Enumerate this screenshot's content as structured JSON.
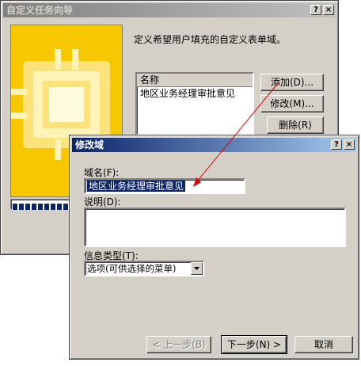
{
  "back_window": {
    "title": "自定义任务向导",
    "help_btn": "?",
    "close_btn": "×",
    "description": "定义希望用户填充的自定义表单域。",
    "list_header": "名称",
    "list_items": [
      "地区业务经理审批意见"
    ],
    "add_button": "添加(D)...",
    "modify_button": "修改(M)...",
    "delete_button": "删除(R)"
  },
  "dialog": {
    "title": "修改域",
    "help_btn": "?",
    "close_btn": "×",
    "field_name_label": "域名(F):",
    "field_name_value": "地区业务经理审批意见",
    "description_label": "说明(D):",
    "description_value": "",
    "info_type_label": "信息类型(T):",
    "info_type_value": "选项(可供选择的菜单)",
    "back_button": "< 上一步(B)",
    "next_button": "下一步(N) >",
    "cancel_button": "取消"
  },
  "colors": {
    "title_active": "#0a246a",
    "title_inactive": "#808080",
    "wizard_art": "#f5c400",
    "annotation_arrow": "#e00000"
  }
}
